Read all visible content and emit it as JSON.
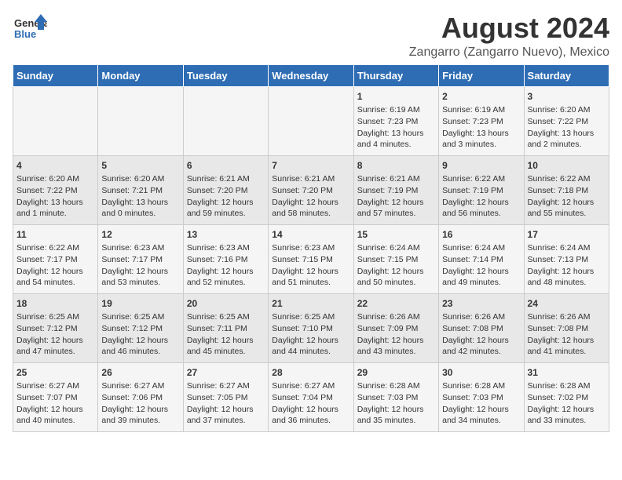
{
  "logo": {
    "general": "General",
    "blue": "Blue"
  },
  "title": "August 2024",
  "subtitle": "Zangarro (Zangarro Nuevo), Mexico",
  "days_header": [
    "Sunday",
    "Monday",
    "Tuesday",
    "Wednesday",
    "Thursday",
    "Friday",
    "Saturday"
  ],
  "weeks": [
    [
      {
        "day": "",
        "info": ""
      },
      {
        "day": "",
        "info": ""
      },
      {
        "day": "",
        "info": ""
      },
      {
        "day": "",
        "info": ""
      },
      {
        "day": "1",
        "info": "Sunrise: 6:19 AM\nSunset: 7:23 PM\nDaylight: 13 hours\nand 4 minutes."
      },
      {
        "day": "2",
        "info": "Sunrise: 6:19 AM\nSunset: 7:23 PM\nDaylight: 13 hours\nand 3 minutes."
      },
      {
        "day": "3",
        "info": "Sunrise: 6:20 AM\nSunset: 7:22 PM\nDaylight: 13 hours\nand 2 minutes."
      }
    ],
    [
      {
        "day": "4",
        "info": "Sunrise: 6:20 AM\nSunset: 7:22 PM\nDaylight: 13 hours\nand 1 minute."
      },
      {
        "day": "5",
        "info": "Sunrise: 6:20 AM\nSunset: 7:21 PM\nDaylight: 13 hours\nand 0 minutes."
      },
      {
        "day": "6",
        "info": "Sunrise: 6:21 AM\nSunset: 7:20 PM\nDaylight: 12 hours\nand 59 minutes."
      },
      {
        "day": "7",
        "info": "Sunrise: 6:21 AM\nSunset: 7:20 PM\nDaylight: 12 hours\nand 58 minutes."
      },
      {
        "day": "8",
        "info": "Sunrise: 6:21 AM\nSunset: 7:19 PM\nDaylight: 12 hours\nand 57 minutes."
      },
      {
        "day": "9",
        "info": "Sunrise: 6:22 AM\nSunset: 7:19 PM\nDaylight: 12 hours\nand 56 minutes."
      },
      {
        "day": "10",
        "info": "Sunrise: 6:22 AM\nSunset: 7:18 PM\nDaylight: 12 hours\nand 55 minutes."
      }
    ],
    [
      {
        "day": "11",
        "info": "Sunrise: 6:22 AM\nSunset: 7:17 PM\nDaylight: 12 hours\nand 54 minutes."
      },
      {
        "day": "12",
        "info": "Sunrise: 6:23 AM\nSunset: 7:17 PM\nDaylight: 12 hours\nand 53 minutes."
      },
      {
        "day": "13",
        "info": "Sunrise: 6:23 AM\nSunset: 7:16 PM\nDaylight: 12 hours\nand 52 minutes."
      },
      {
        "day": "14",
        "info": "Sunrise: 6:23 AM\nSunset: 7:15 PM\nDaylight: 12 hours\nand 51 minutes."
      },
      {
        "day": "15",
        "info": "Sunrise: 6:24 AM\nSunset: 7:15 PM\nDaylight: 12 hours\nand 50 minutes."
      },
      {
        "day": "16",
        "info": "Sunrise: 6:24 AM\nSunset: 7:14 PM\nDaylight: 12 hours\nand 49 minutes."
      },
      {
        "day": "17",
        "info": "Sunrise: 6:24 AM\nSunset: 7:13 PM\nDaylight: 12 hours\nand 48 minutes."
      }
    ],
    [
      {
        "day": "18",
        "info": "Sunrise: 6:25 AM\nSunset: 7:12 PM\nDaylight: 12 hours\nand 47 minutes."
      },
      {
        "day": "19",
        "info": "Sunrise: 6:25 AM\nSunset: 7:12 PM\nDaylight: 12 hours\nand 46 minutes."
      },
      {
        "day": "20",
        "info": "Sunrise: 6:25 AM\nSunset: 7:11 PM\nDaylight: 12 hours\nand 45 minutes."
      },
      {
        "day": "21",
        "info": "Sunrise: 6:25 AM\nSunset: 7:10 PM\nDaylight: 12 hours\nand 44 minutes."
      },
      {
        "day": "22",
        "info": "Sunrise: 6:26 AM\nSunset: 7:09 PM\nDaylight: 12 hours\nand 43 minutes."
      },
      {
        "day": "23",
        "info": "Sunrise: 6:26 AM\nSunset: 7:08 PM\nDaylight: 12 hours\nand 42 minutes."
      },
      {
        "day": "24",
        "info": "Sunrise: 6:26 AM\nSunset: 7:08 PM\nDaylight: 12 hours\nand 41 minutes."
      }
    ],
    [
      {
        "day": "25",
        "info": "Sunrise: 6:27 AM\nSunset: 7:07 PM\nDaylight: 12 hours\nand 40 minutes."
      },
      {
        "day": "26",
        "info": "Sunrise: 6:27 AM\nSunset: 7:06 PM\nDaylight: 12 hours\nand 39 minutes."
      },
      {
        "day": "27",
        "info": "Sunrise: 6:27 AM\nSunset: 7:05 PM\nDaylight: 12 hours\nand 37 minutes."
      },
      {
        "day": "28",
        "info": "Sunrise: 6:27 AM\nSunset: 7:04 PM\nDaylight: 12 hours\nand 36 minutes."
      },
      {
        "day": "29",
        "info": "Sunrise: 6:28 AM\nSunset: 7:03 PM\nDaylight: 12 hours\nand 35 minutes."
      },
      {
        "day": "30",
        "info": "Sunrise: 6:28 AM\nSunset: 7:03 PM\nDaylight: 12 hours\nand 34 minutes."
      },
      {
        "day": "31",
        "info": "Sunrise: 6:28 AM\nSunset: 7:02 PM\nDaylight: 12 hours\nand 33 minutes."
      }
    ]
  ]
}
